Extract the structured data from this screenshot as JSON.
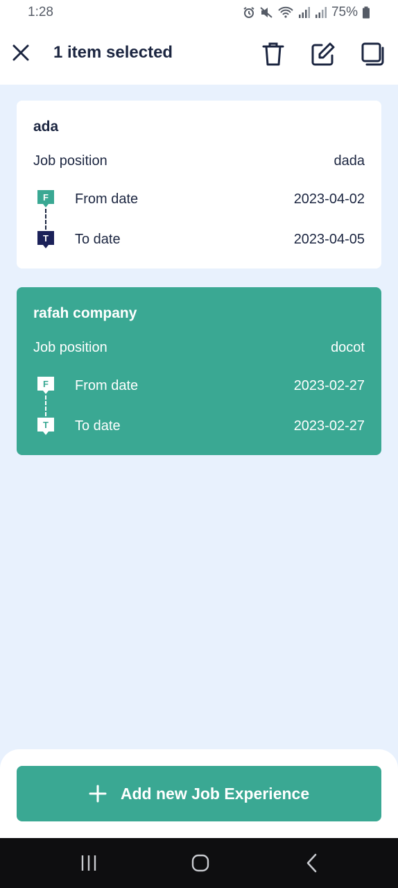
{
  "status_bar": {
    "time": "1:28",
    "battery": "75%",
    "icons": [
      "alarm-icon",
      "mute-icon",
      "wifi-icon",
      "signal-icon",
      "signal-icon",
      "battery-icon"
    ]
  },
  "app_bar": {
    "title": "1 item selected",
    "icons": [
      "close-icon",
      "trash-icon",
      "edit-icon",
      "copy-icon"
    ]
  },
  "experiences": [
    {
      "company": "ada",
      "job_position_label": "Job position",
      "job_position": "dada",
      "from_marker": "F",
      "from_label": "From date",
      "from_date": "2023-04-02",
      "to_marker": "T",
      "to_label": "To date",
      "to_date": "2023-04-05",
      "selected": false
    },
    {
      "company": "rafah company",
      "job_position_label": "Job position",
      "job_position": "docot",
      "from_marker": "F",
      "from_label": "From date",
      "from_date": "2023-02-27",
      "to_marker": "T",
      "to_label": "To date",
      "to_date": "2023-02-27",
      "selected": true
    }
  ],
  "bottom": {
    "add_button_label": "Add new Job Experience",
    "add_icon": "plus-icon"
  },
  "nav_bar": {
    "icons": [
      "recent-apps-icon",
      "home-icon",
      "back-icon"
    ]
  },
  "colors": {
    "accent": "#3aa893",
    "navy": "#1b2540",
    "background": "#e8f1fd"
  }
}
